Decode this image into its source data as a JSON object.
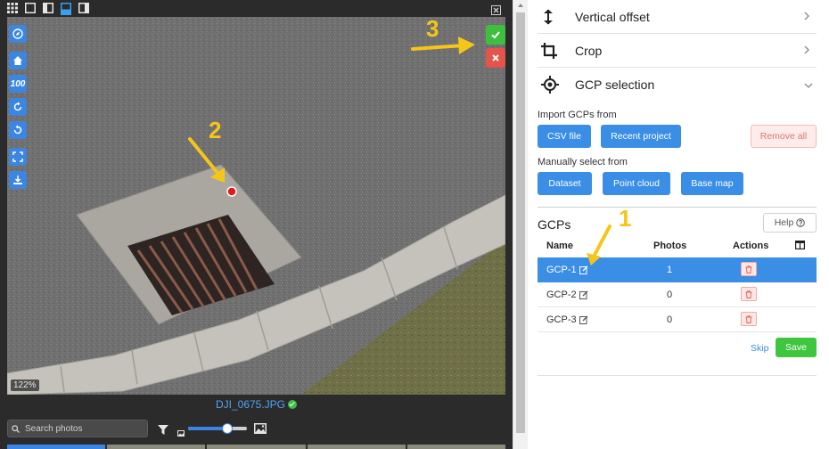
{
  "toolbar": {
    "icons": [
      "grid-icon",
      "single-view-icon",
      "split-view-icon",
      "filmstrip-view-icon",
      "sidebar-view-icon"
    ],
    "active": "filmstrip-view-icon"
  },
  "viewer": {
    "side_tools": [
      "compass-icon",
      "home-icon",
      "zoom-100",
      "rotate-right-icon",
      "rotate-left-icon",
      "fullscreen-icon",
      "download-icon"
    ],
    "zoom_100_label": "100",
    "zoom_badge": "122%",
    "annotations": {
      "one": "1",
      "two": "2",
      "three": "3"
    },
    "colors": {
      "confirm": "#3fbf3f",
      "cancel": "#e5534b",
      "gcp_marker": "#e01b1b",
      "annotation": "#f5c518"
    }
  },
  "photo_footer": {
    "filename": "DJI_0675.JPG",
    "search_placeholder": "Search photos",
    "thumb_size": 0.66
  },
  "panel": {
    "sections": [
      {
        "label": "Vertical offset",
        "icon": "vertical-arrows-icon",
        "expanded": false
      },
      {
        "label": "Crop",
        "icon": "crop-icon",
        "expanded": false
      },
      {
        "label": "GCP selection",
        "icon": "target-icon",
        "expanded": true
      }
    ],
    "import_label": "Import GCPs from",
    "import_buttons": [
      "CSV file",
      "Recent project"
    ],
    "remove_all": "Remove all",
    "manual_label": "Manually select from",
    "manual_buttons": [
      "Dataset",
      "Point cloud",
      "Base map"
    ],
    "gcps_title": "GCPs",
    "help_label": "Help",
    "table": {
      "headers": [
        "Name",
        "Photos",
        "Actions"
      ],
      "rows": [
        {
          "name": "GCP-1",
          "photos": "1",
          "selected": true
        },
        {
          "name": "GCP-2",
          "photos": "0",
          "selected": false
        },
        {
          "name": "GCP-3",
          "photos": "0",
          "selected": false
        }
      ]
    },
    "skip": "Skip",
    "save": "Save",
    "accent": "#3b8ee6"
  }
}
